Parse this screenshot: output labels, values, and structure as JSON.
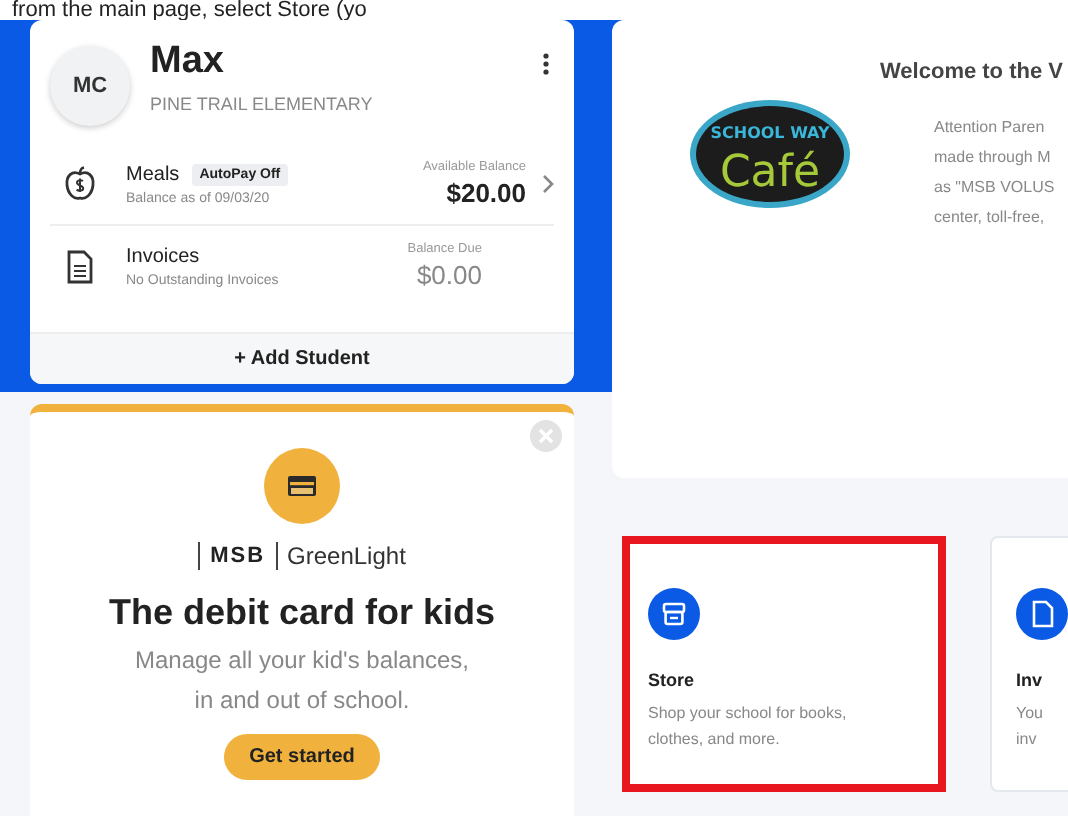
{
  "caption": "from the main page, select Store (yo",
  "student": {
    "initials": "MC",
    "name": "Max",
    "school": "PINE TRAIL ELEMENTARY",
    "add_button": "+ Add Student",
    "rows": [
      {
        "kind": "meals",
        "title": "Meals",
        "badge": "AutoPay Off",
        "subtitle": "Balance as of 09/03/20",
        "amount_label": "Available Balance",
        "amount": "$20.00"
      },
      {
        "kind": "invoices",
        "title": "Invoices",
        "subtitle": "No Outstanding Invoices",
        "amount_label": "Balance Due",
        "amount": "$0.00"
      }
    ]
  },
  "promo": {
    "brand_left": "MSB",
    "brand_right": "GreenLight",
    "title": "The debit card for kids",
    "lines": [
      "Manage all your kid's balances,",
      "in and out of school."
    ],
    "button": "Get started"
  },
  "welcome": {
    "title": "Welcome to the V",
    "logo_top": "SCHOOL WAY",
    "logo_main": "Café",
    "lines": [
      "Attention Paren",
      "made through M",
      "as \"MSB VOLUS",
      "center, toll-free,"
    ]
  },
  "tiles": [
    {
      "kind": "store",
      "title": "Store",
      "lines": [
        "Shop your school for books,",
        "clothes, and more."
      ],
      "highlighted": true
    },
    {
      "kind": "invoices",
      "title": "Inv",
      "lines": [
        "You",
        "inv"
      ],
      "highlighted": false
    }
  ]
}
